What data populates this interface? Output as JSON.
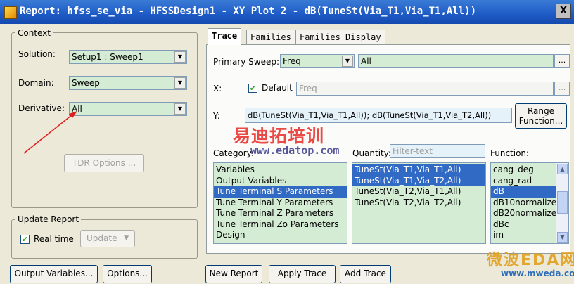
{
  "window": {
    "title": "Report: hfss_se_via - HFSSDesign1 - XY Plot 2 - dB(TuneSt(Via_T1,Via_T1,All))",
    "close_label": "X"
  },
  "context": {
    "title": "Context",
    "solution_label": "Solution:",
    "solution_value": "Setup1 : Sweep1",
    "domain_label": "Domain:",
    "domain_value": "Sweep",
    "derivative_label": "Derivative:",
    "derivative_value": "All",
    "tdr_button": "TDR Options ..."
  },
  "update": {
    "title": "Update Report",
    "realtime_label": "Real time",
    "realtime_checked": true,
    "update_button": "Update"
  },
  "tabs": [
    {
      "label": "Trace",
      "active": true
    },
    {
      "label": "Families"
    },
    {
      "label": "Families Display"
    }
  ],
  "trace": {
    "primary_sweep_label": "Primary Sweep:",
    "primary_sweep_value": "Freq",
    "primary_sweep_range": "All",
    "x_label": "X:",
    "x_default_label": "Default",
    "x_default_checked": true,
    "x_value": "Freq",
    "y_label": "Y:",
    "y_value": "dB(TuneSt(Via_T1,Via_T1,All)); dB(TuneSt(Via_T1,Via_T2,All))",
    "range_function_line1": "Range",
    "range_function_line2": "Function...",
    "category_label": "Category:",
    "quantity_label": "Quantity:",
    "quantity_filter_placeholder": "Filter-text",
    "function_label": "Function:",
    "categories": [
      {
        "label": "Variables"
      },
      {
        "label": "Output Variables"
      },
      {
        "label": "Tune Terminal S Parameters",
        "selected": true
      },
      {
        "label": "Tune Terminal Y Parameters"
      },
      {
        "label": "Tune Terminal Z Parameters"
      },
      {
        "label": "Tune Terminal Zo Parameters"
      },
      {
        "label": "Design"
      }
    ],
    "quantities": [
      {
        "label": "TuneSt(Via_T1,Via_T1,All)",
        "selected": true
      },
      {
        "label": "TuneSt(Via_T1,Via_T2,All)",
        "selected": true
      },
      {
        "label": "TuneSt(Via_T2,Via_T1,All)"
      },
      {
        "label": "TuneSt(Via_T2,Via_T2,All)"
      }
    ],
    "functions": [
      {
        "label": "cang_deg"
      },
      {
        "label": "cang_rad"
      },
      {
        "label": "dB",
        "selected": true
      },
      {
        "label": "dB10normalize"
      },
      {
        "label": "dB20normalize"
      },
      {
        "label": "dBc"
      },
      {
        "label": "im"
      }
    ]
  },
  "bottom_buttons": {
    "output_variables": "Output Variables...",
    "options": "Options...",
    "new_report": "New Report",
    "apply_trace": "Apply Trace",
    "add_trace": "Add Trace"
  },
  "ellipsis": "...",
  "watermarks": {
    "cn_brand": "易迪拓培训",
    "url1": "www.edatop.com",
    "eda_brand": "微波EDA网",
    "url2": "www.mweda.com"
  },
  "colors": {
    "titlebar": "#1e5bc6",
    "field_bg": "#d4ecd4",
    "selection": "#316ac5",
    "annotation_arrow": "#e02020"
  }
}
